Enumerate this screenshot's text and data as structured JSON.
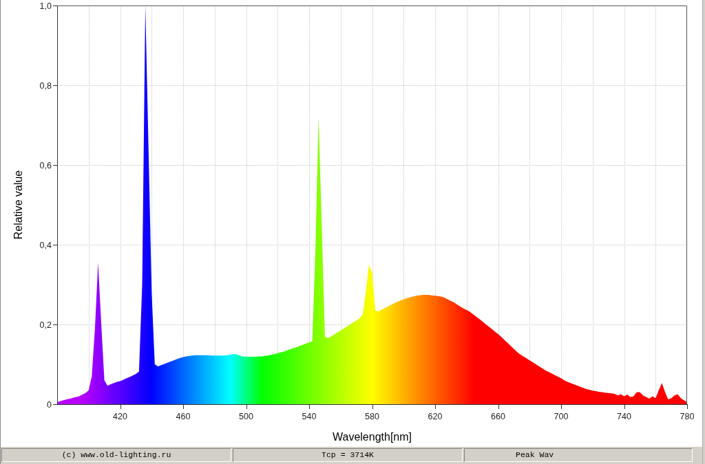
{
  "chart": {
    "chart_data": {
      "type": "area",
      "xlabel": "Wavelength[nm]",
      "ylabel": "Relative value",
      "xlim": [
        380,
        780
      ],
      "ylim": [
        0,
        1
      ],
      "grid": true,
      "xticks": [
        420,
        460,
        500,
        540,
        580,
        620,
        660,
        700,
        740,
        780
      ],
      "yticks": [
        {
          "value": 0,
          "label": "0"
        },
        {
          "value": 0.2,
          "label": "0,2"
        },
        {
          "value": 0.4,
          "label": "0,4"
        },
        {
          "value": 0.6,
          "label": "0,6"
        },
        {
          "value": 0.8,
          "label": "0,8"
        },
        {
          "value": 1,
          "label": "1,0"
        }
      ],
      "x": [
        380,
        382,
        384,
        386,
        388,
        390,
        392,
        394,
        396,
        398,
        400,
        402,
        404,
        406,
        408,
        410,
        412,
        414,
        416,
        418,
        420,
        422,
        424,
        426,
        428,
        430,
        432,
        434,
        436,
        438,
        440,
        442,
        444,
        446,
        448,
        450,
        452,
        454,
        456,
        458,
        460,
        462,
        464,
        466,
        468,
        470,
        472,
        474,
        476,
        478,
        480,
        482,
        484,
        486,
        488,
        490,
        492,
        494,
        496,
        498,
        500,
        502,
        504,
        506,
        508,
        510,
        512,
        514,
        516,
        518,
        520,
        522,
        524,
        526,
        528,
        530,
        532,
        534,
        536,
        538,
        540,
        542,
        544,
        546,
        548,
        550,
        552,
        554,
        556,
        558,
        560,
        562,
        564,
        566,
        568,
        570,
        572,
        574,
        576,
        578,
        580,
        582,
        584,
        586,
        588,
        590,
        592,
        594,
        596,
        598,
        600,
        602,
        604,
        606,
        608,
        610,
        612,
        614,
        616,
        618,
        620,
        622,
        624,
        626,
        628,
        630,
        632,
        634,
        636,
        638,
        640,
        642,
        644,
        646,
        648,
        650,
        652,
        654,
        656,
        658,
        660,
        662,
        664,
        666,
        668,
        670,
        672,
        674,
        676,
        678,
        680,
        682,
        684,
        686,
        688,
        690,
        692,
        694,
        696,
        698,
        700,
        702,
        704,
        706,
        708,
        710,
        712,
        714,
        716,
        718,
        720,
        722,
        724,
        726,
        728,
        730,
        732,
        734,
        736,
        738,
        740,
        742,
        744,
        746,
        748,
        750,
        752,
        754,
        756,
        758,
        760,
        762,
        764,
        766,
        768,
        770,
        772,
        774,
        776,
        778,
        780
      ],
      "values": [
        0.005,
        0.008,
        0.01,
        0.012,
        0.014,
        0.016,
        0.018,
        0.02,
        0.024,
        0.028,
        0.035,
        0.07,
        0.19,
        0.355,
        0.2,
        0.06,
        0.046,
        0.05,
        0.053,
        0.056,
        0.058,
        0.061,
        0.065,
        0.068,
        0.072,
        0.076,
        0.082,
        0.3,
        1,
        0.64,
        0.28,
        0.1,
        0.095,
        0.098,
        0.101,
        0.104,
        0.107,
        0.11,
        0.113,
        0.116,
        0.118,
        0.12,
        0.121,
        0.122,
        0.123,
        0.123,
        0.123,
        0.123,
        0.123,
        0.122,
        0.122,
        0.122,
        0.122,
        0.122,
        0.123,
        0.124,
        0.126,
        0.125,
        0.122,
        0.12,
        0.119,
        0.119,
        0.119,
        0.119,
        0.12,
        0.12,
        0.121,
        0.122,
        0.124,
        0.126,
        0.128,
        0.13,
        0.132,
        0.135,
        0.138,
        0.14,
        0.143,
        0.146,
        0.149,
        0.152,
        0.155,
        0.158,
        0.38,
        0.72,
        0.45,
        0.17,
        0.166,
        0.17,
        0.175,
        0.18,
        0.185,
        0.19,
        0.195,
        0.2,
        0.205,
        0.21,
        0.215,
        0.225,
        0.28,
        0.35,
        0.33,
        0.235,
        0.233,
        0.237,
        0.241,
        0.245,
        0.249,
        0.253,
        0.257,
        0.26,
        0.263,
        0.266,
        0.268,
        0.27,
        0.272,
        0.273,
        0.274,
        0.274,
        0.274,
        0.273,
        0.272,
        0.271,
        0.27,
        0.267,
        0.263,
        0.259,
        0.255,
        0.25,
        0.245,
        0.24,
        0.236,
        0.232,
        0.226,
        0.22,
        0.214,
        0.208,
        0.201,
        0.195,
        0.189,
        0.182,
        0.176,
        0.169,
        0.161,
        0.154,
        0.146,
        0.139,
        0.131,
        0.125,
        0.12,
        0.115,
        0.11,
        0.105,
        0.1,
        0.095,
        0.09,
        0.085,
        0.081,
        0.077,
        0.073,
        0.069,
        0.065,
        0.06,
        0.056,
        0.053,
        0.05,
        0.047,
        0.044,
        0.041,
        0.038,
        0.036,
        0.034,
        0.033,
        0.031,
        0.03,
        0.029,
        0.028,
        0.027,
        0.026,
        0.022,
        0.025,
        0.02,
        0.024,
        0.018,
        0.02,
        0.03,
        0.03,
        0.022,
        0.018,
        0.014,
        0.02,
        0.015,
        0.035,
        0.053,
        0.03,
        0.012,
        0.015,
        0.022,
        0.025,
        0.015,
        0.01,
        0.005
      ]
    }
  },
  "status_bar": [
    "(c) www.old-lighting.ru",
    "Tcp = 3714K",
    "Peak Wav"
  ]
}
